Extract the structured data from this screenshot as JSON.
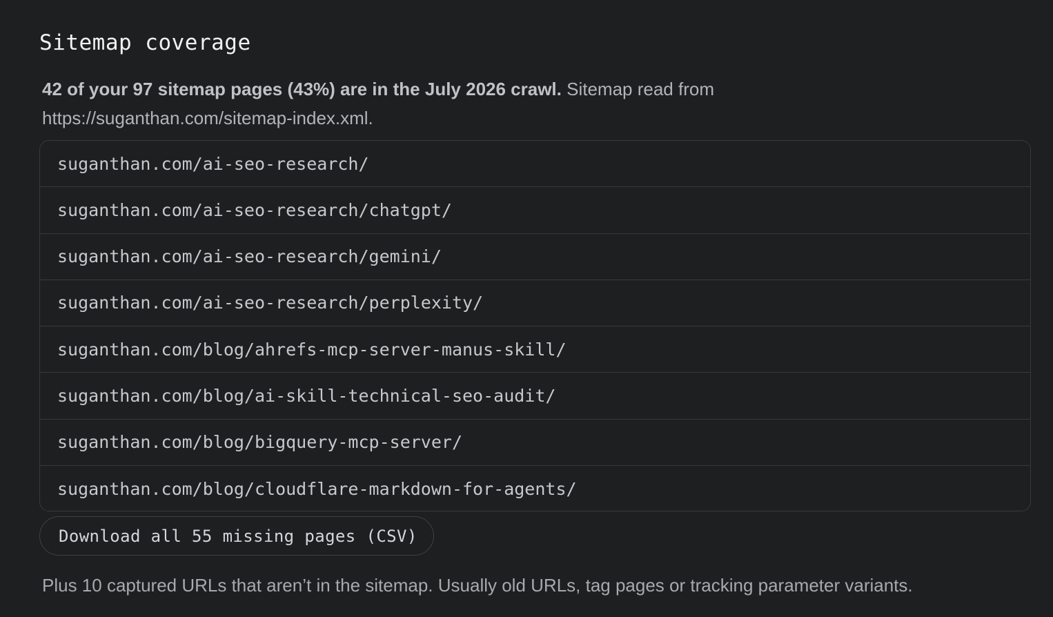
{
  "section": {
    "title": "Sitemap coverage",
    "summary_bold": "42 of your 97 sitemap pages (43%) are in the July 2026 crawl.",
    "summary_rest": " Sitemap read from https://suganthan.com/sitemap-index.xml."
  },
  "urls": [
    "suganthan.com/ai-seo-research/",
    "suganthan.com/ai-seo-research/chatgpt/",
    "suganthan.com/ai-seo-research/gemini/",
    "suganthan.com/ai-seo-research/perplexity/",
    "suganthan.com/blog/ahrefs-mcp-server-manus-skill/",
    "suganthan.com/blog/ai-skill-technical-seo-audit/",
    "suganthan.com/blog/bigquery-mcp-server/",
    "suganthan.com/blog/cloudflare-markdown-for-agents/"
  ],
  "download_button": {
    "label": "Download all 55 missing pages (CSV)"
  },
  "footnote": "Plus 10 captured URLs that aren’t in the sitemap. Usually old URLs, tag pages or tracking parameter variants."
}
